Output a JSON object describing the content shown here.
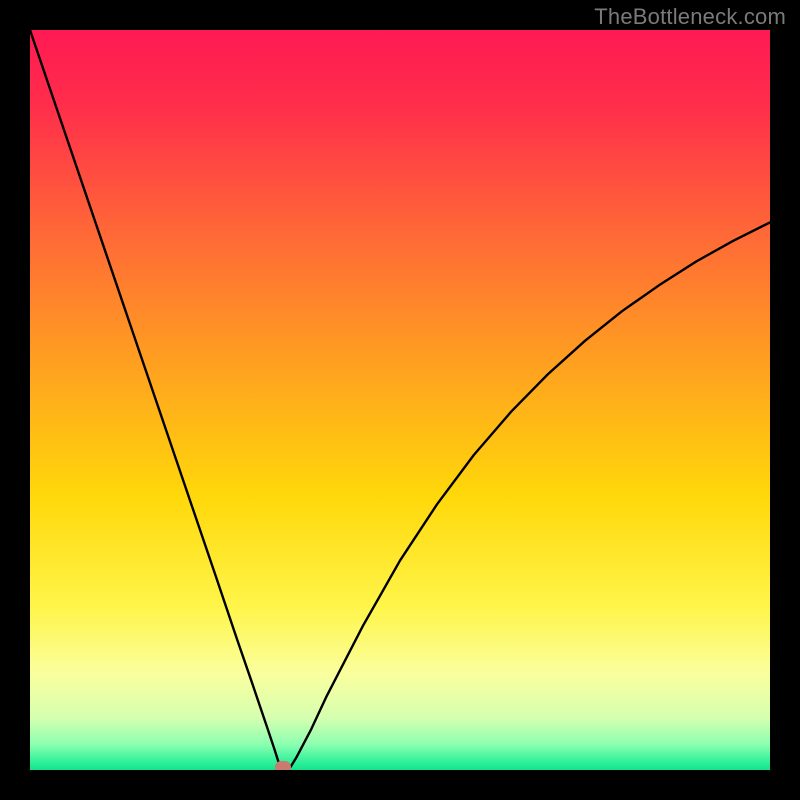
{
  "watermark": "TheBottleneck.com",
  "chart_data": {
    "type": "line",
    "title": "",
    "xlabel": "",
    "ylabel": "",
    "xlim": [
      0,
      100
    ],
    "ylim": [
      0,
      100
    ],
    "series": [
      {
        "name": "bottleneck-curve",
        "x": [
          0,
          5,
          10,
          15,
          20,
          25,
          28,
          30,
          32,
          33,
          33.8,
          34,
          34.5,
          35.2,
          36,
          38,
          40,
          45,
          50,
          55,
          60,
          65,
          70,
          75,
          80,
          85,
          90,
          95,
          100
        ],
        "y": [
          100,
          85.3,
          70.6,
          55.9,
          41.2,
          26.5,
          17.6,
          11.8,
          5.9,
          2.9,
          0.4,
          0.1,
          0.1,
          0.4,
          1.7,
          5.5,
          9.8,
          19.5,
          28.3,
          35.9,
          42.6,
          48.4,
          53.5,
          58.0,
          62.0,
          65.5,
          68.7,
          71.5,
          74.0
        ]
      }
    ],
    "marker": {
      "x": 34.2,
      "y": 0.4,
      "color": "#c97b6e"
    },
    "background_gradient_stops": [
      {
        "pos": 0.0,
        "color": "#ff1a53"
      },
      {
        "pos": 0.1,
        "color": "#ff2d4b"
      },
      {
        "pos": 0.28,
        "color": "#ff6a36"
      },
      {
        "pos": 0.46,
        "color": "#ffa31f"
      },
      {
        "pos": 0.63,
        "color": "#ffd80a"
      },
      {
        "pos": 0.78,
        "color": "#fff54a"
      },
      {
        "pos": 0.87,
        "color": "#faff9e"
      },
      {
        "pos": 0.93,
        "color": "#d5ffb0"
      },
      {
        "pos": 0.965,
        "color": "#8dffb0"
      },
      {
        "pos": 0.99,
        "color": "#2cf09a"
      },
      {
        "pos": 1.0,
        "color": "#17e08c"
      }
    ]
  }
}
